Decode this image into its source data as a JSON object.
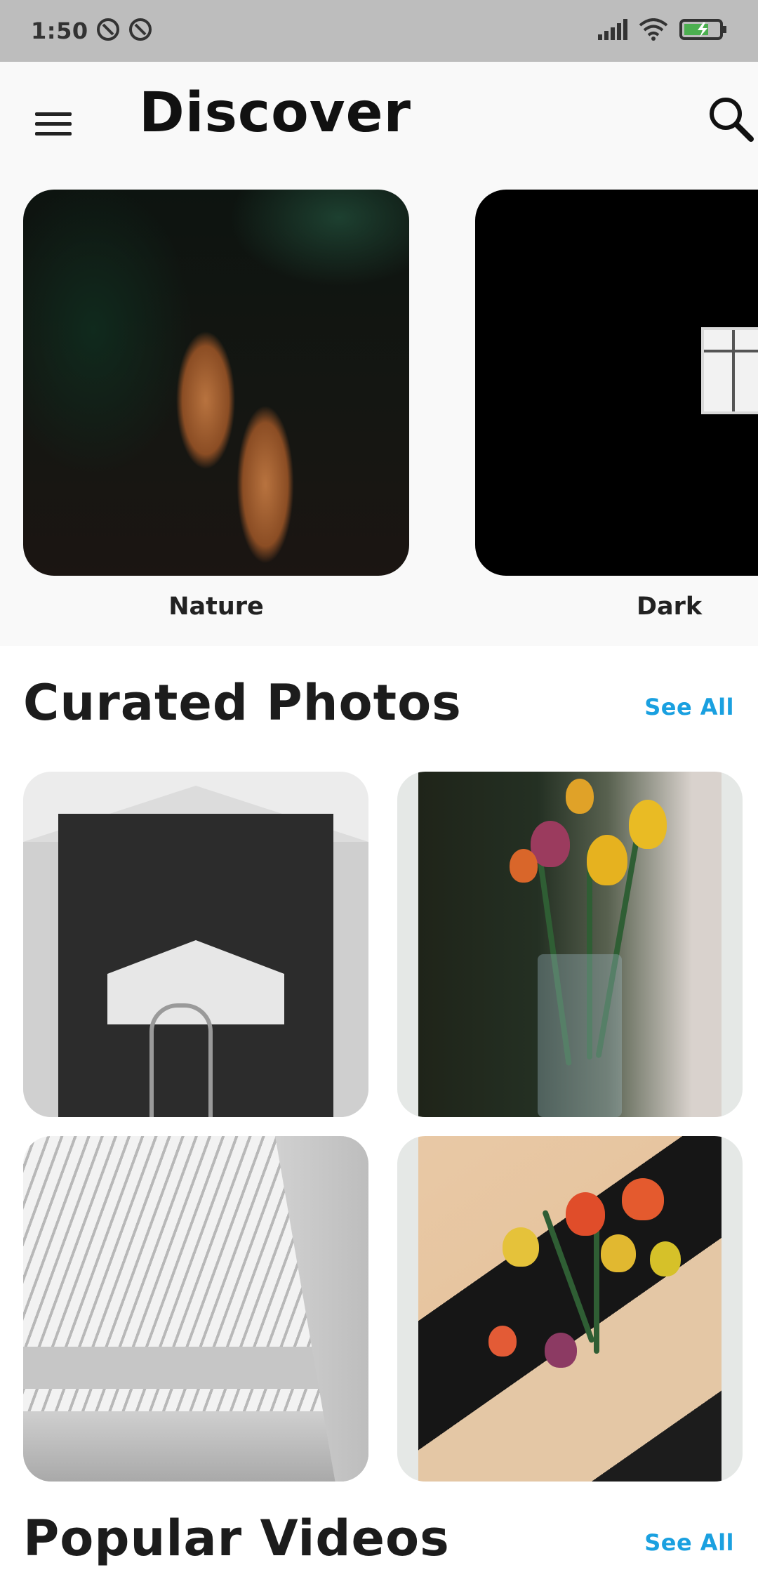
{
  "status_bar": {
    "time": "1:50",
    "left_icons": [
      "at-sign-icon",
      "at-sign-icon"
    ],
    "right_icons": [
      "signal-icon",
      "wifi-icon",
      "battery-charging-icon"
    ]
  },
  "header": {
    "menu_icon": "hamburger-menu-icon",
    "title": "Discover",
    "search_icon": "search-icon"
  },
  "categories": [
    {
      "label": "Nature",
      "image": "pine-cones-photo"
    },
    {
      "label": "Dark",
      "image": "dark-window-photo"
    }
  ],
  "curated": {
    "title": "Curated Photos",
    "see_all": "See All",
    "photos": [
      {
        "image": "architecture-bw-photo"
      },
      {
        "image": "tulips-vase-photo"
      },
      {
        "image": "oculus-interior-photo"
      },
      {
        "image": "tulips-table-photo"
      }
    ]
  },
  "popular_videos": {
    "title": "Popular Videos",
    "see_all": "See All"
  },
  "colors": {
    "accent": "#1aa0e0",
    "status_bar": "#bdbdbd",
    "header_bg": "#f9f9f9",
    "battery_charge": "#4caf50"
  }
}
